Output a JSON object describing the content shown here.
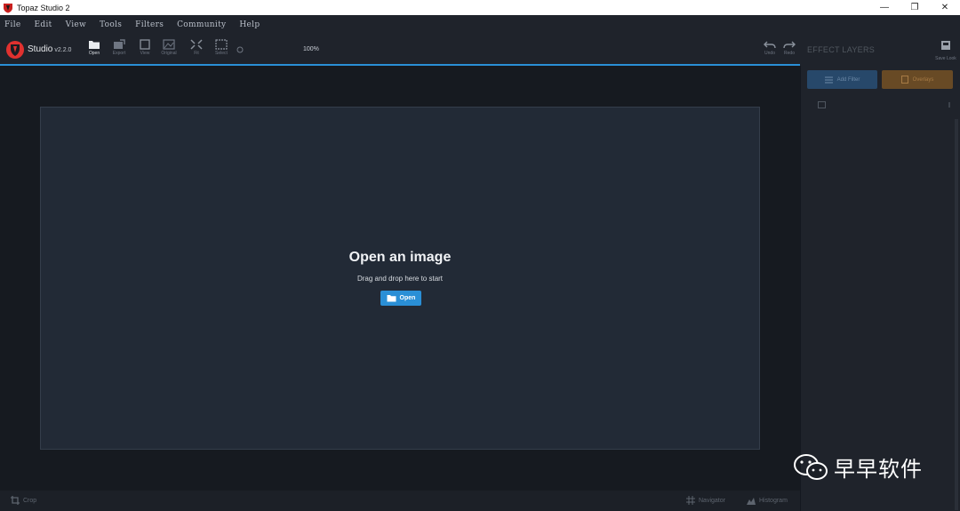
{
  "window": {
    "title": "Topaz Studio 2",
    "controls": {
      "minimize": "—",
      "restore": "❐",
      "close": "✕"
    }
  },
  "menu": {
    "items": [
      "File",
      "Edit",
      "View",
      "Tools",
      "Filters",
      "Community",
      "Help"
    ]
  },
  "toolbar": {
    "app_name": "Studio",
    "version": "v2.2.0",
    "tools": [
      {
        "label": "Open",
        "icon": "folder-icon"
      },
      {
        "label": "Export",
        "icon": "export-icon"
      },
      {
        "label": "View",
        "icon": "view-icon"
      },
      {
        "label": "Original",
        "icon": "image-icon"
      },
      {
        "label": "Fit",
        "icon": "fit-icon"
      },
      {
        "label": "Select",
        "icon": "select-icon"
      }
    ],
    "zoom": "100%",
    "undo_label": "Undo",
    "redo_label": "Redo"
  },
  "right_panel": {
    "title": "EFFECT LAYERS",
    "save_look_label": "Save Look",
    "add_filter_label": "Add Filter",
    "overlays_label": "Overlays"
  },
  "canvas": {
    "title": "Open an image",
    "subtitle": "Drag and drop here to start",
    "open_button": "Open"
  },
  "bottombar": {
    "crop": "Crop",
    "navigator": "Navigator",
    "histogram": "Histogram"
  },
  "watermark": {
    "text": "早早软件"
  },
  "colors": {
    "accent": "#2a8fd6",
    "add_filter": "#27486a",
    "overlays": "#684a25",
    "logo": "#e0312f"
  }
}
